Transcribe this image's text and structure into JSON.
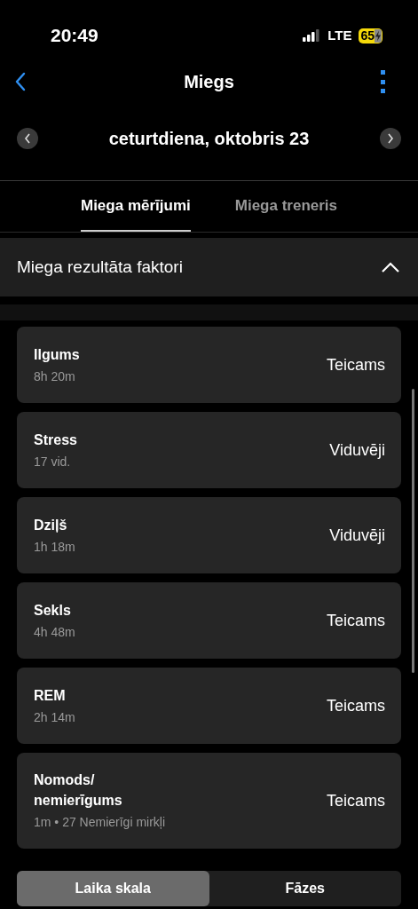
{
  "status_bar": {
    "time": "20:49",
    "network": "LTE",
    "battery": "65",
    "charging": true
  },
  "header": {
    "title": "Miegs"
  },
  "date_nav": {
    "label": "ceturtdiena, oktobris 23"
  },
  "tabs": [
    {
      "label": "Miega mērījumi",
      "selected": true
    },
    {
      "label": "Miega treneris",
      "selected": false
    }
  ],
  "section": {
    "title": "Miega rezultāta faktori",
    "expanded": true
  },
  "factors": [
    {
      "name": "Ilgums",
      "detail": "8h 20m",
      "rating": "Teicams"
    },
    {
      "name": "Stress",
      "detail": "17 vid.",
      "rating": "Viduvēji"
    },
    {
      "name": "Dziļš",
      "detail": "1h 18m",
      "rating": "Viduvēji"
    },
    {
      "name": "Sekls",
      "detail": "4h 48m",
      "rating": "Teicams"
    },
    {
      "name": "REM",
      "detail": "2h 14m",
      "rating": "Teicams"
    },
    {
      "name": "Nomods/ nemierīgums",
      "detail": "1m • 27 Nemierīgi mirkļi",
      "rating": "Teicams"
    }
  ],
  "view_toggle": [
    {
      "label": "Laika skala",
      "selected": true
    },
    {
      "label": "Fāzes",
      "selected": false
    }
  ]
}
